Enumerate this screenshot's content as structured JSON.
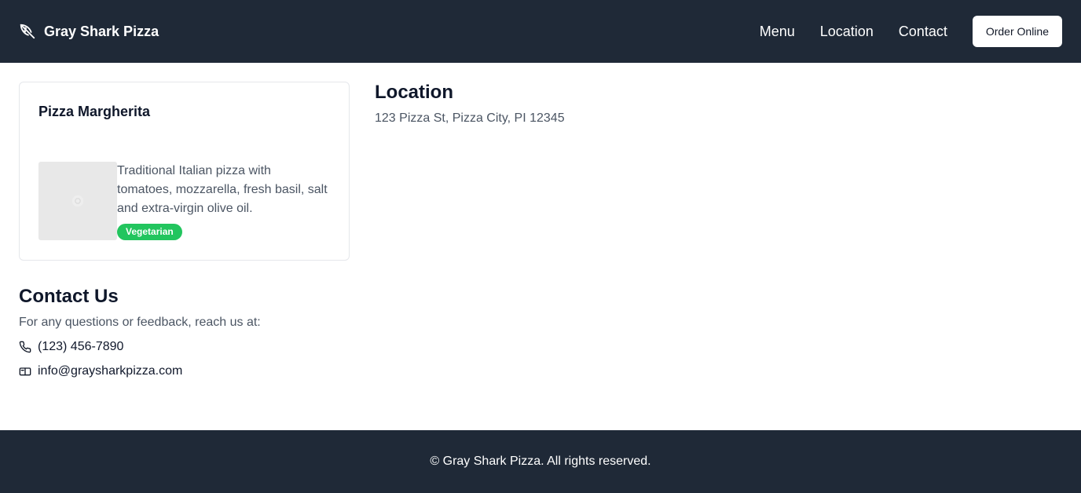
{
  "header": {
    "brand_name": "Gray Shark Pizza",
    "brand_icon": "pizza-slice-icon",
    "nav": [
      {
        "label": "Menu"
      },
      {
        "label": "Location"
      },
      {
        "label": "Contact"
      }
    ],
    "order_button": "Order Online"
  },
  "menu_item": {
    "title": "Pizza Margherita",
    "image_icon": "image-placeholder-icon",
    "description": "Traditional Italian pizza with tomatoes, mozzarella, fresh basil, salt and extra-virgin olive oil.",
    "badge": "Vegetarian",
    "badge_color": "#22c55e"
  },
  "location": {
    "heading": "Location",
    "address": "123 Pizza St, Pizza City, PI 12345"
  },
  "contact": {
    "heading": "Contact Us",
    "lead": "For any questions or feedback, reach us at:",
    "phone_icon": "phone-icon",
    "phone": "(123) 456-7890",
    "email_icon": "mail-icon",
    "email": "info@graysharkpizza.com"
  },
  "footer": {
    "text": "© Gray Shark Pizza. All rights reserved."
  },
  "colors": {
    "header_bg": "#1f2937",
    "footer_bg": "#1f2937",
    "accent_green": "#22c55e"
  }
}
